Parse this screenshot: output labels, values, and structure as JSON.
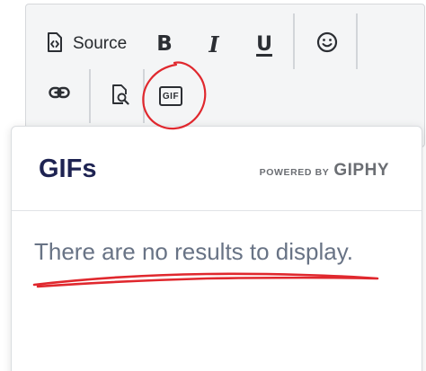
{
  "toolbar": {
    "source_label": "Source",
    "bold_glyph": "B",
    "italic_glyph": "I",
    "underline_glyph": "U",
    "gif_label": "GIF",
    "icons": [
      "source-code-icon",
      "bold-icon",
      "italic-icon",
      "underline-icon",
      "emoji-icon",
      "link-icon",
      "preview-icon",
      "gif-icon"
    ]
  },
  "gif_panel": {
    "title": "GIFs",
    "powered_by": "POWERED BY",
    "brand": "GIPHY",
    "empty_message": "There are no results to display."
  },
  "colors": {
    "toolbar_bg": "#f4f5f6",
    "title": "#1e2352",
    "message": "#687385",
    "annotation": "#e0282e"
  }
}
